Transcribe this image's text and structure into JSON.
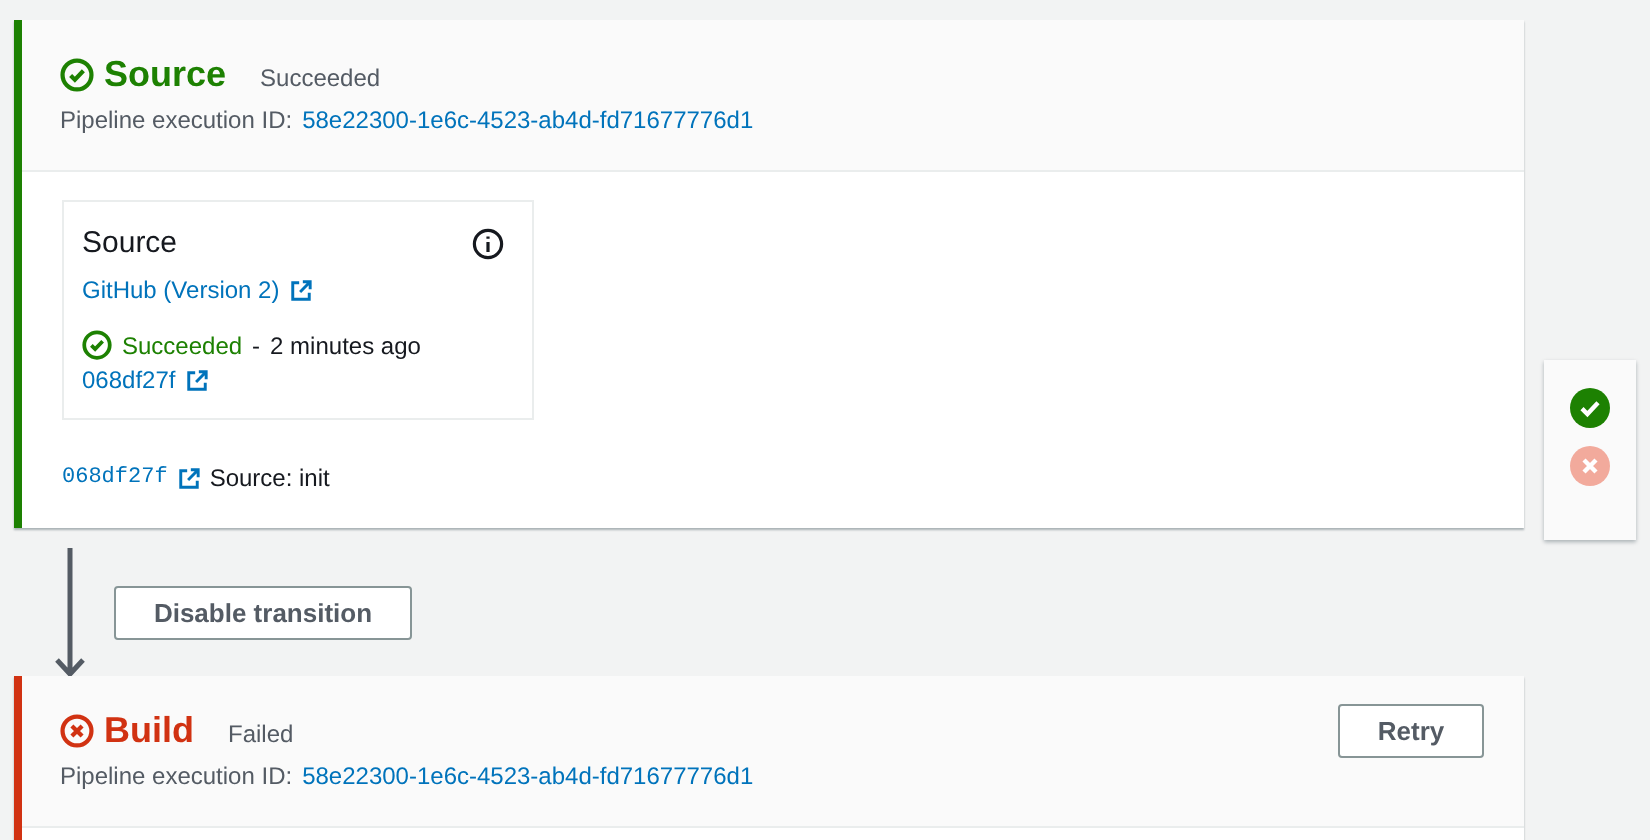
{
  "stages": [
    {
      "name": "Source",
      "kind": "succeeded",
      "status_label": "Succeeded",
      "execution_label": "Pipeline execution ID:",
      "execution_id": "58e22300-1e6c-4523-ab4d-fd71677776d1",
      "actions": [
        {
          "title": "Source",
          "provider": "GitHub (Version 2)",
          "kind": "succeeded",
          "status_label": "Succeeded",
          "separator": "-",
          "time": "2 minutes ago",
          "revision": "068df27f"
        }
      ],
      "revision": {
        "commit": "068df27f",
        "message": "Source: init"
      },
      "review": [
        {
          "kind": "approve",
          "disabled": false
        },
        {
          "kind": "reject",
          "disabled": true
        }
      ]
    },
    {
      "name": "Build",
      "kind": "failed",
      "status_label": "Failed",
      "execution_label": "Pipeline execution ID:",
      "execution_id": "58e22300-1e6c-4523-ab4d-fd71677776d1",
      "retry": "Retry"
    }
  ],
  "transition": {
    "button": "Disable transition"
  }
}
